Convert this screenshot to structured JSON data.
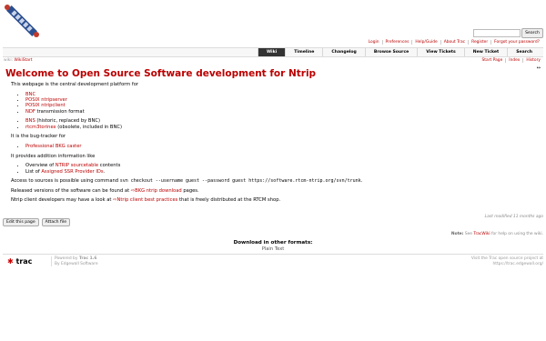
{
  "search": {
    "placeholder": "",
    "button": "Search"
  },
  "metanav": [
    "Login",
    "Preferences",
    "Help/Guide",
    "About Trac",
    "Register",
    "Forgot your password?"
  ],
  "mainnav": [
    "Wiki",
    "Timeline",
    "Changelog",
    "Browse Source",
    "View Tickets",
    "New Ticket",
    "Search"
  ],
  "breadcrumb": {
    "prefix": "wiki:",
    "page": "WikiStart"
  },
  "ctxtnav": [
    "Start Page",
    "Index",
    "History"
  ],
  "arrows": "↔",
  "title": "Welcome to Open Source Software development for Ntrip",
  "intro": "This webpage is the central development platform for",
  "list1": [
    {
      "link": "BNC",
      "rest": ""
    },
    {
      "link": "POSIX ntripserver",
      "rest": ""
    },
    {
      "link": "POSIX ntripclient",
      "rest": ""
    },
    {
      "link": "NDF",
      "rest": " transmission format"
    }
  ],
  "list2": [
    {
      "link": "BNS",
      "rest": " (historic, replaced by BNC)"
    },
    {
      "link": "rtcm3torinex",
      "rest": " (obsolete, included in BNC)"
    }
  ],
  "bugtracker": "It is the bug-tracker for",
  "list3": [
    {
      "link": "Professional BKG caster",
      "rest": ""
    }
  ],
  "additional": "It provides addition information like",
  "list4": [
    {
      "pre": "Overview of ",
      "link": "NTRIP sourcetable",
      "rest": " contents"
    },
    {
      "pre": "List of ",
      "link": "Assigned SSR Provider IDs",
      "rest": "."
    }
  ],
  "access": {
    "pre": "Access to sources is possible using command ",
    "code": "svn checkout --username guest --password guest https://software.rtcm-ntrip.org/svn/trunk",
    "post": "."
  },
  "released": {
    "pre": "Released versions of the software can be found at ",
    "link": "BKG ntrip download",
    "post": " pages."
  },
  "bestpractice": {
    "pre": "Ntrip client developers may have a look at ",
    "link": "Ntrip client best practices",
    "post": " that is freely distributed at the RTCM shop."
  },
  "buttons": {
    "edit": "Edit this page",
    "attach": "Attach file"
  },
  "lastmod": {
    "prefix": "Last modified ",
    "age": "11 months ago"
  },
  "help": {
    "note": "Note:",
    "see": " See ",
    "link": "TracWiki",
    "rest": " for help on using the wiki."
  },
  "download": {
    "title": "Download in other formats:",
    "plain": "Plain Text"
  },
  "footer": {
    "logo": "trac",
    "powered_pre": "Powered by ",
    "powered_link": "Trac 1.6",
    "by": "By ",
    "by_link": "Edgewall Software",
    "visit1": "Visit the Trac open source project at",
    "visit2": "https://trac.edgewall.org/"
  },
  "colors": {
    "accent": "#bb0000",
    "nav_active": "#333333"
  }
}
